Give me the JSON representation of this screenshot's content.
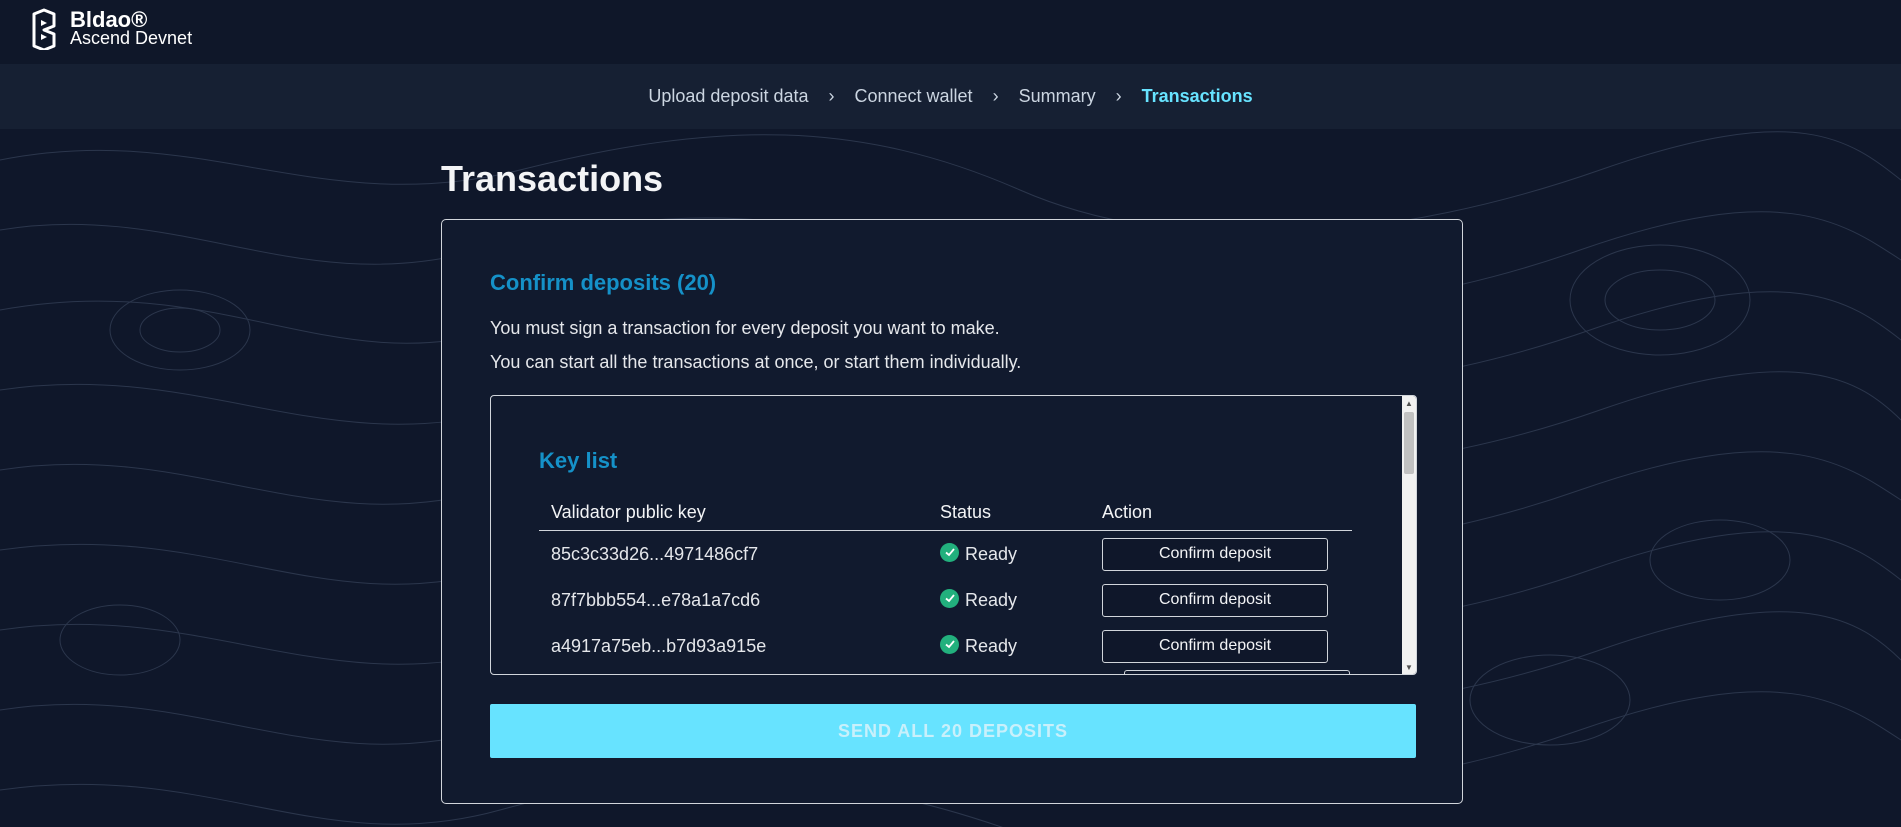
{
  "header": {
    "brand_name": "Bldao®",
    "brand_sub": "Ascend Devnet"
  },
  "stepper": {
    "steps": [
      {
        "label": "Upload deposit data",
        "active": false
      },
      {
        "label": "Connect wallet",
        "active": false
      },
      {
        "label": "Summary",
        "active": false
      },
      {
        "label": "Transactions",
        "active": true
      }
    ],
    "separator": "›"
  },
  "page": {
    "title": "Transactions"
  },
  "card": {
    "title": "Confirm deposits (20)",
    "line1": "You must sign a transaction for every deposit you want to make.",
    "line2": "You can start all the transactions at once, or start them individually."
  },
  "key_list": {
    "title": "Key list",
    "columns": [
      "Validator public key",
      "Status",
      "Action"
    ],
    "rows": [
      {
        "key": "85c3c33d26...4971486cf7",
        "status": "Ready",
        "action": "Confirm deposit"
      },
      {
        "key": "87f7bbb554...e78a1a7cd6",
        "status": "Ready",
        "action": "Confirm deposit"
      },
      {
        "key": "a4917a75eb...b7d93a915e",
        "status": "Ready",
        "action": "Confirm deposit"
      }
    ]
  },
  "send_all": {
    "label": "SEND ALL 20 DEPOSITS"
  },
  "colors": {
    "background": "#0f172a",
    "accent": "#67e3ff",
    "heading_blue": "#1591c8",
    "ready_green": "#22b07d"
  }
}
